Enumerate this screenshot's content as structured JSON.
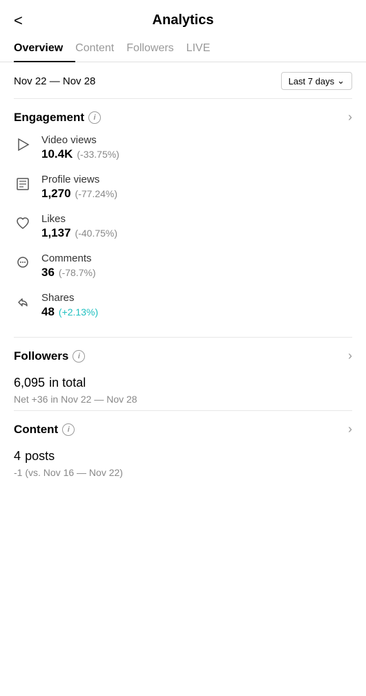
{
  "header": {
    "back_label": "<",
    "title": "Analytics"
  },
  "tabs": [
    {
      "label": "Overview",
      "active": true
    },
    {
      "label": "Content",
      "active": false
    },
    {
      "label": "Followers",
      "active": false
    },
    {
      "label": "LIVE",
      "active": false
    }
  ],
  "date_range": {
    "label": "Nov 22 — Nov 28",
    "selector": "Last 7 days"
  },
  "engagement": {
    "section_title": "Engagement",
    "metrics": [
      {
        "label": "Video views",
        "value": "10.4K",
        "change": "(-33.75%)",
        "positive": false,
        "icon": "play"
      },
      {
        "label": "Profile views",
        "value": "1,270",
        "change": "(-77.24%)",
        "positive": false,
        "icon": "profile"
      },
      {
        "label": "Likes",
        "value": "1,137",
        "change": "(-40.75%)",
        "positive": false,
        "icon": "heart"
      },
      {
        "label": "Comments",
        "value": "36",
        "change": "(-78.7%)",
        "positive": false,
        "icon": "comment"
      },
      {
        "label": "Shares",
        "value": "48",
        "change": "(+2.13%)",
        "positive": true,
        "icon": "share"
      }
    ]
  },
  "followers": {
    "section_title": "Followers",
    "total_value": "6,095",
    "total_label": "in total",
    "net_label": "Net +36 in Nov 22 — Nov 28"
  },
  "content": {
    "section_title": "Content",
    "posts_value": "4",
    "posts_label": "posts",
    "compare_label": "-1 (vs. Nov 16 — Nov 22)"
  }
}
